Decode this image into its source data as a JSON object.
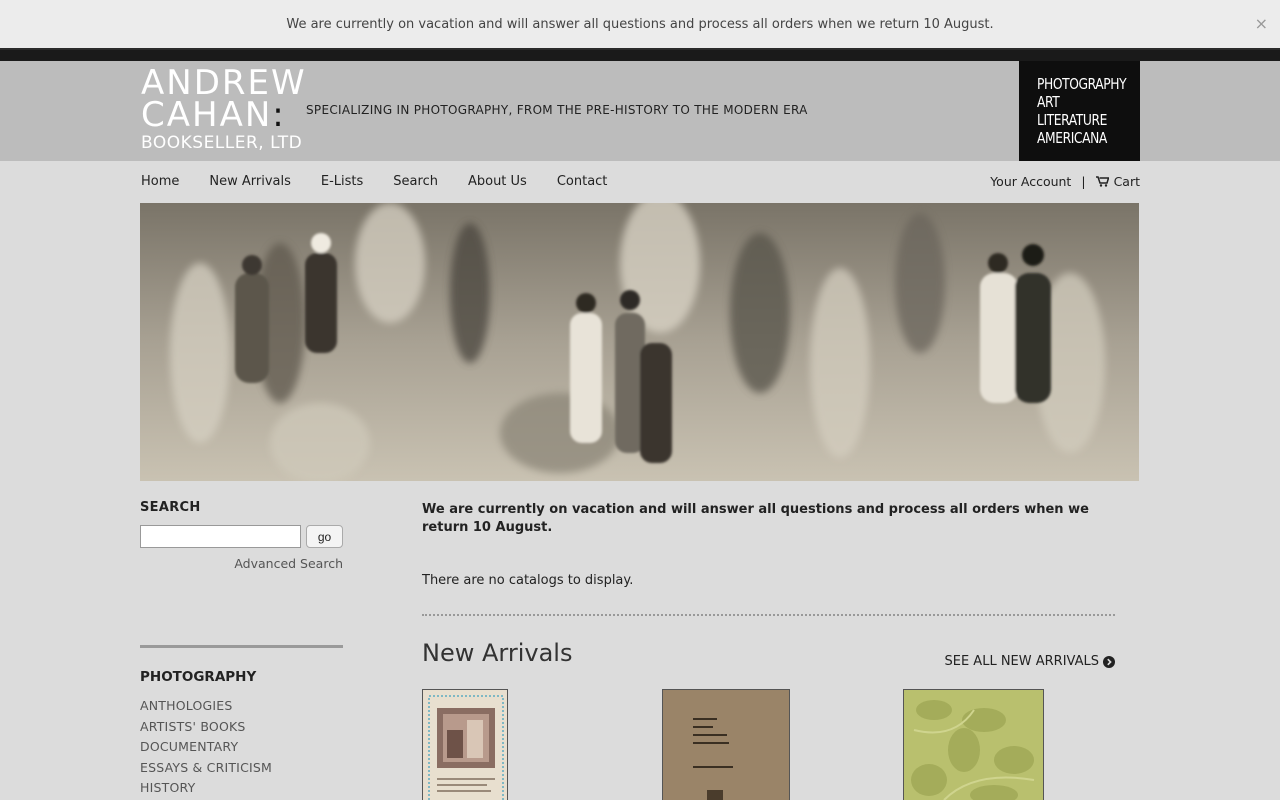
{
  "notice_bar": {
    "text": "We are currently on vacation and will answer all questions and process all orders when we return 10 August.",
    "close": "×"
  },
  "brand": {
    "line1": "ANDREW",
    "line2": "CAHAN",
    "colon": ":",
    "line3": "BOOKSELLER, LTD",
    "tagline": "SPECIALIZING IN PHOTOGRAPHY, FROM THE PRE-HISTORY TO THE MODERN ERA"
  },
  "subjects": [
    "PHOTOGRAPHY",
    "ART",
    "LITERATURE",
    "AMERICANA"
  ],
  "nav": {
    "items": [
      "Home",
      "New Arrivals",
      "E-Lists",
      "Search",
      "About Us",
      "Contact"
    ]
  },
  "account": {
    "your_account": "Your Account",
    "separator": "|",
    "cart": "Cart"
  },
  "sidebar": {
    "search_heading": "SEARCH",
    "search_value": "",
    "go_label": "go",
    "advanced_search": "Advanced Search",
    "category_heading": "PHOTOGRAPHY",
    "categories": [
      "ANTHOLOGIES",
      "ARTISTS' BOOKS",
      "DOCUMENTARY",
      "ESSAYS & CRITICISM",
      "HISTORY"
    ]
  },
  "main": {
    "notice": "We are currently on vacation and will answer all questions and process all orders when we return 10 August.",
    "no_catalogs": "There are no catalogs to display.",
    "new_arrivals_title": "New Arrivals",
    "see_all": "SEE ALL NEW ARRIVALS"
  },
  "colors": {
    "page_bg": "#dcdcdc",
    "header_bg": "#bcbcbc",
    "subjects_bg": "#0e0e0e",
    "notice_bg": "#ececec"
  }
}
